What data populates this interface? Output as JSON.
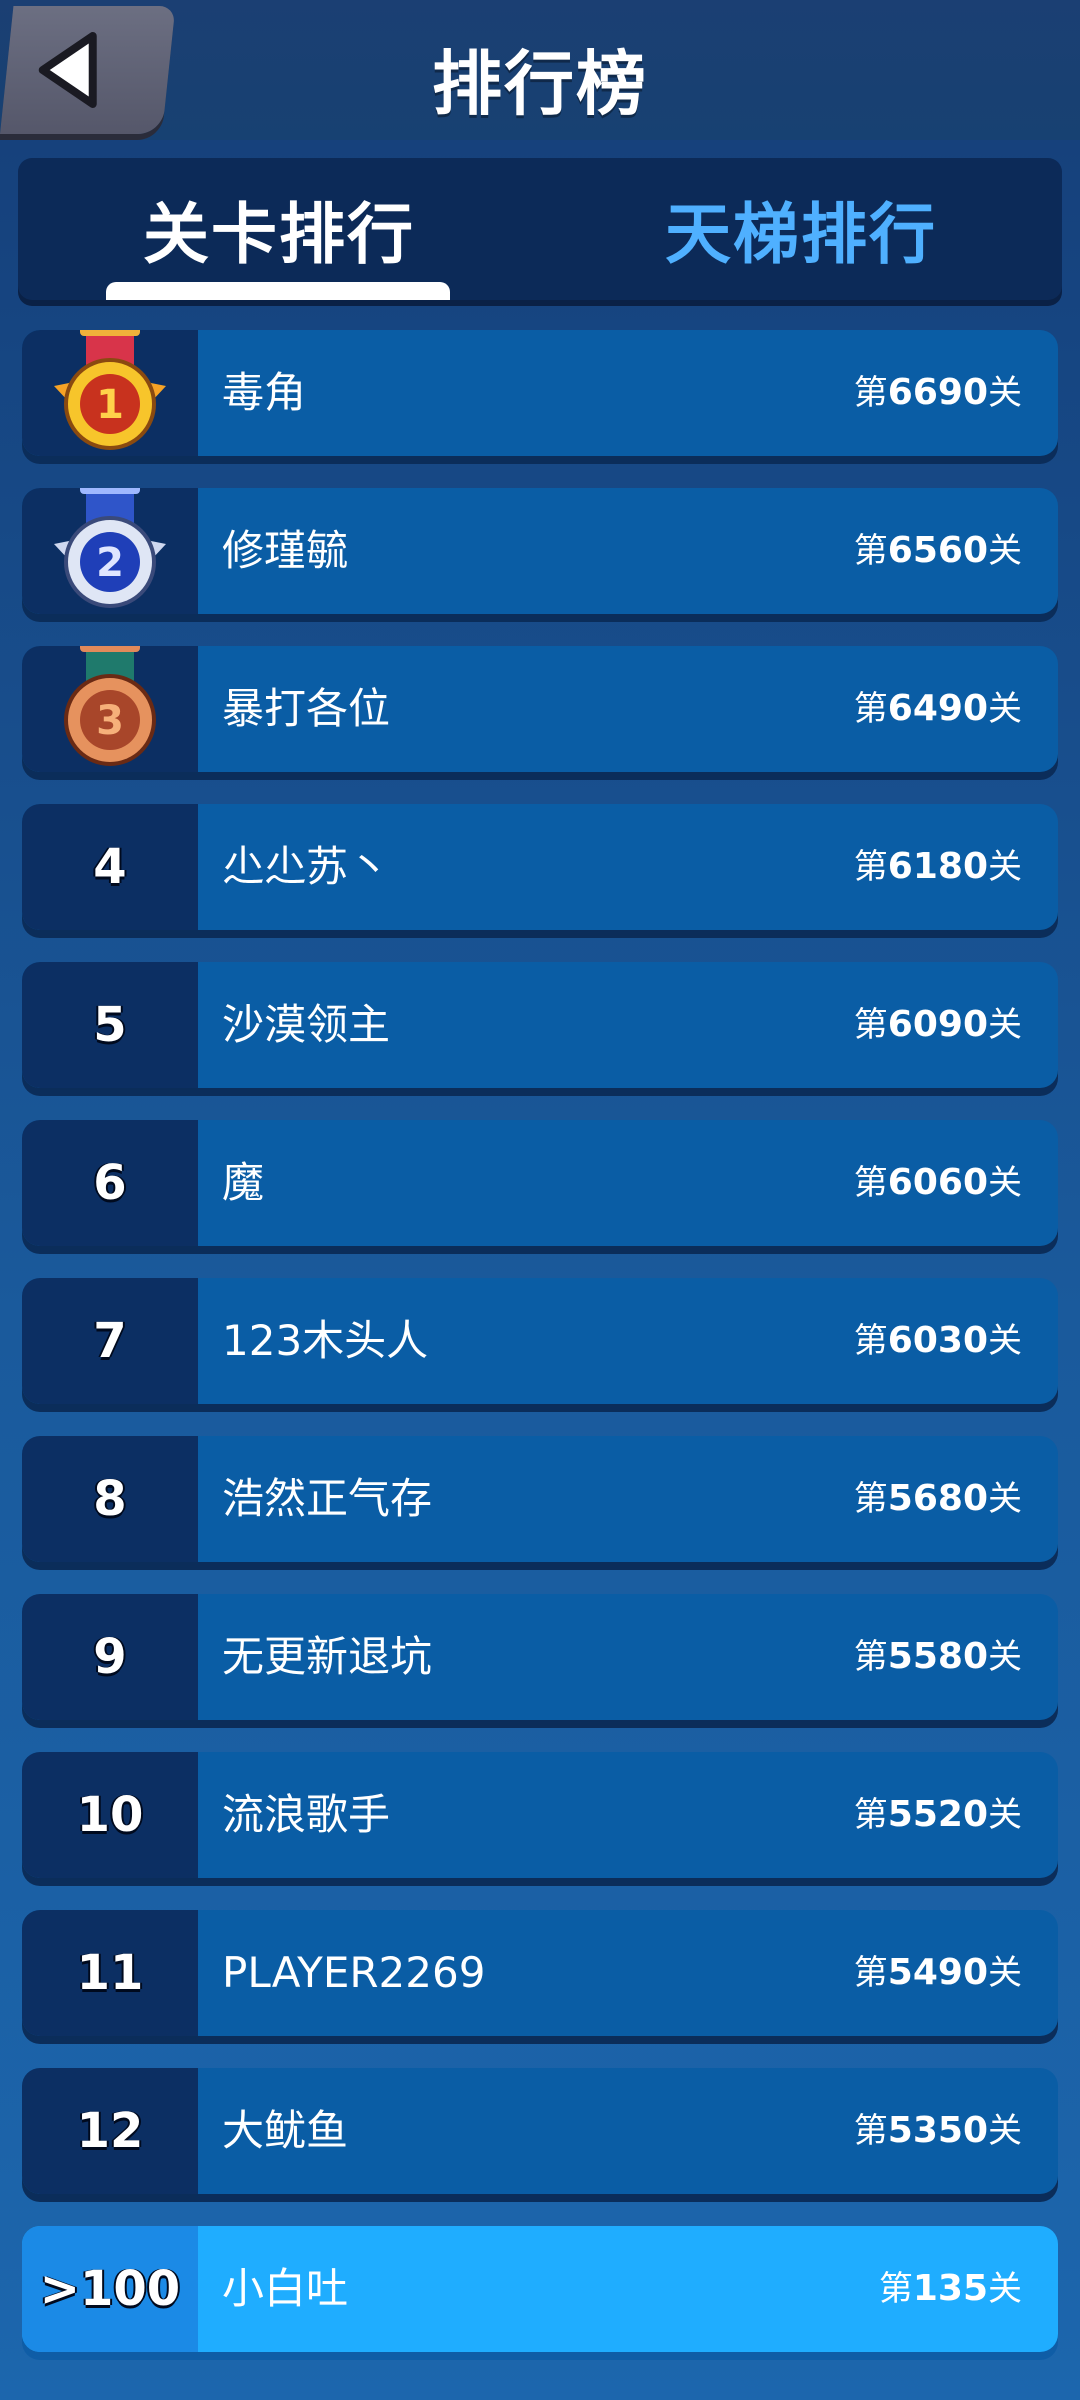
{
  "header": {
    "title": "排行榜",
    "back_icon": "back-arrow-icon"
  },
  "tabs": [
    {
      "label": "关卡排行",
      "active": true
    },
    {
      "label": "天梯排行",
      "active": false
    }
  ],
  "colors": {
    "accent": "#4fb0ff",
    "row": "#0a5da5",
    "rank_box": "#0c2f63",
    "self_row": "#1fadff"
  },
  "rows": [
    {
      "rank": "1",
      "medal": "gold-medal-icon",
      "name": "毒角",
      "level_prefix": "第",
      "level": "6690",
      "level_suffix": "关"
    },
    {
      "rank": "2",
      "medal": "silver-medal-icon",
      "name": "修瑾毓",
      "level_prefix": "第",
      "level": "6560",
      "level_suffix": "关"
    },
    {
      "rank": "3",
      "medal": "bronze-medal-icon",
      "name": "暴打各位",
      "level_prefix": "第",
      "level": "6490",
      "level_suffix": "关"
    },
    {
      "rank": "4",
      "name": "尐尐苏丶",
      "level_prefix": "第",
      "level": "6180",
      "level_suffix": "关"
    },
    {
      "rank": "5",
      "name": "沙漠领主",
      "level_prefix": "第",
      "level": "6090",
      "level_suffix": "关"
    },
    {
      "rank": "6",
      "name": "魔",
      "level_prefix": "第",
      "level": "6060",
      "level_suffix": "关"
    },
    {
      "rank": "7",
      "name": "123木头人",
      "level_prefix": "第",
      "level": "6030",
      "level_suffix": "关"
    },
    {
      "rank": "8",
      "name": "浩然正气存",
      "level_prefix": "第",
      "level": "5680",
      "level_suffix": "关"
    },
    {
      "rank": "9",
      "name": "无更新退坑",
      "level_prefix": "第",
      "level": "5580",
      "level_suffix": "关"
    },
    {
      "rank": "10",
      "name": "流浪歌手",
      "level_prefix": "第",
      "level": "5520",
      "level_suffix": "关"
    },
    {
      "rank": "11",
      "name": "PLAYER2269",
      "level_prefix": "第",
      "level": "5490",
      "level_suffix": "关"
    },
    {
      "rank": "12",
      "name": "大鱿鱼",
      "level_prefix": "第",
      "level": "5350",
      "level_suffix": "关"
    }
  ],
  "self_row": {
    "rank": ">100",
    "name": "小白吐",
    "level_prefix": "第",
    "level": "135",
    "level_suffix": "关"
  }
}
